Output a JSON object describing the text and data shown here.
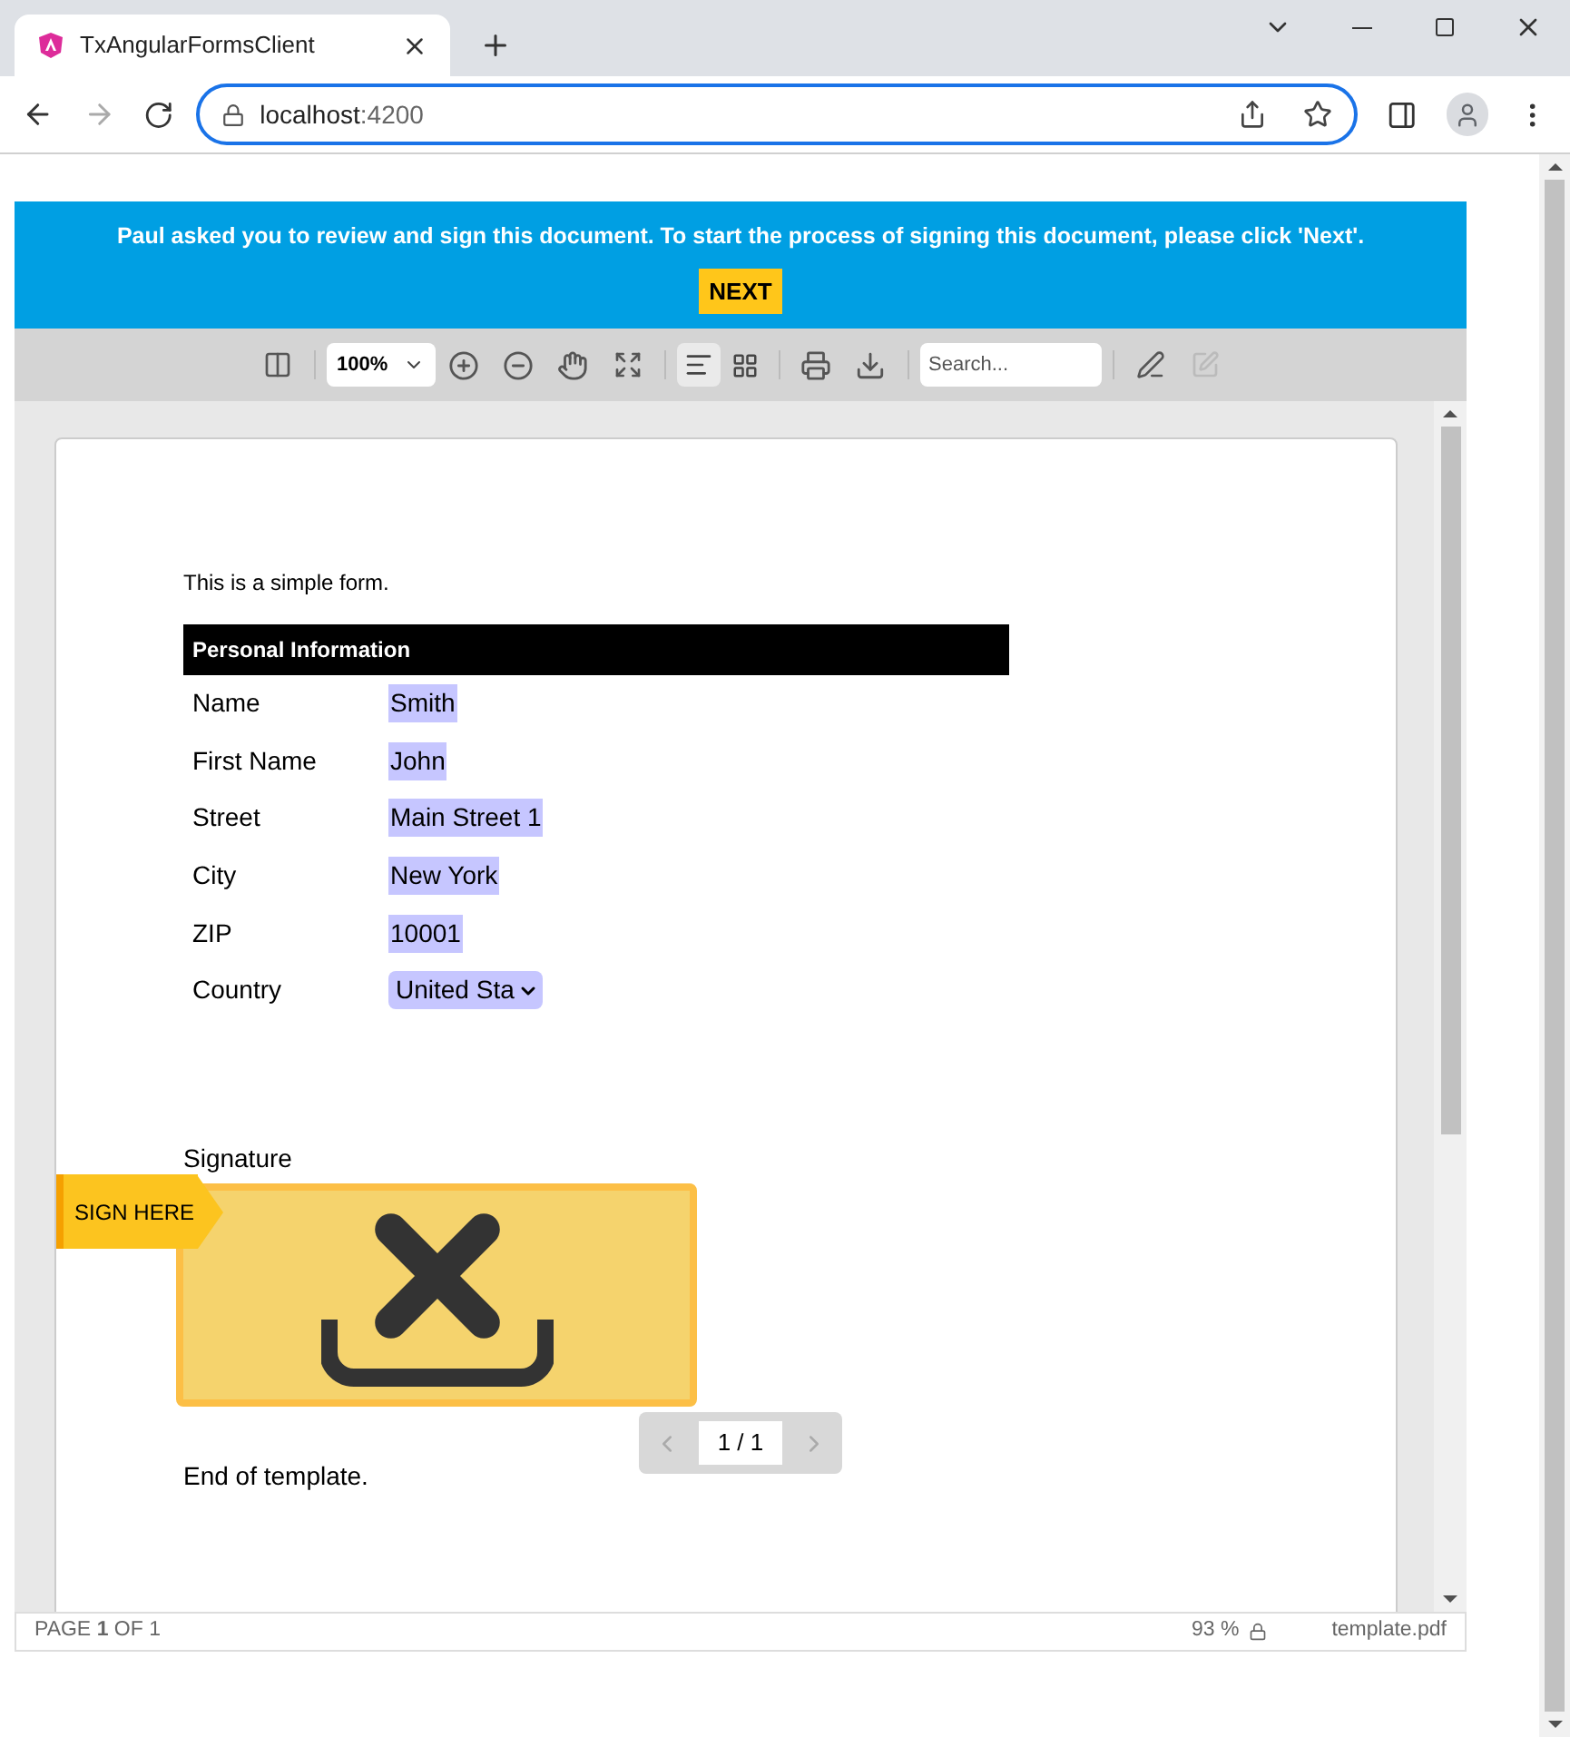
{
  "browser": {
    "tab_title": "TxAngularFormsClient",
    "url_host": "localhost",
    "url_port": ":4200"
  },
  "banner": {
    "message": "Paul asked you to review and sign this document. To start the process of signing this document, please click 'Next'.",
    "button": "NEXT"
  },
  "toolbar": {
    "zoom": "100%",
    "search_placeholder": "Search...",
    "view_modes": [
      {
        "kind": "continuous",
        "selected": true
      },
      {
        "kind": "grid",
        "selected": false
      }
    ]
  },
  "document": {
    "intro": "This is a simple form.",
    "section_title": "Personal Information",
    "fields": [
      {
        "label": "Name",
        "value": "Smith",
        "kind": "text"
      },
      {
        "label": "First Name",
        "value": "John",
        "kind": "text"
      },
      {
        "label": "Street",
        "value": "Main Street 1",
        "kind": "text"
      },
      {
        "label": "City",
        "value": "New York",
        "kind": "text"
      },
      {
        "label": "ZIP",
        "value": "10001",
        "kind": "text"
      },
      {
        "label": "Country",
        "value": "United Sta",
        "kind": "select"
      }
    ],
    "signature_label": "Signature",
    "sign_here": "SIGN HERE",
    "end_text": "End of template."
  },
  "pager": {
    "current": "1 / 1"
  },
  "status_bar": {
    "page_info": "PAGE **1** OF 1",
    "zoom": "93 %",
    "file_name": "template.pdf"
  }
}
